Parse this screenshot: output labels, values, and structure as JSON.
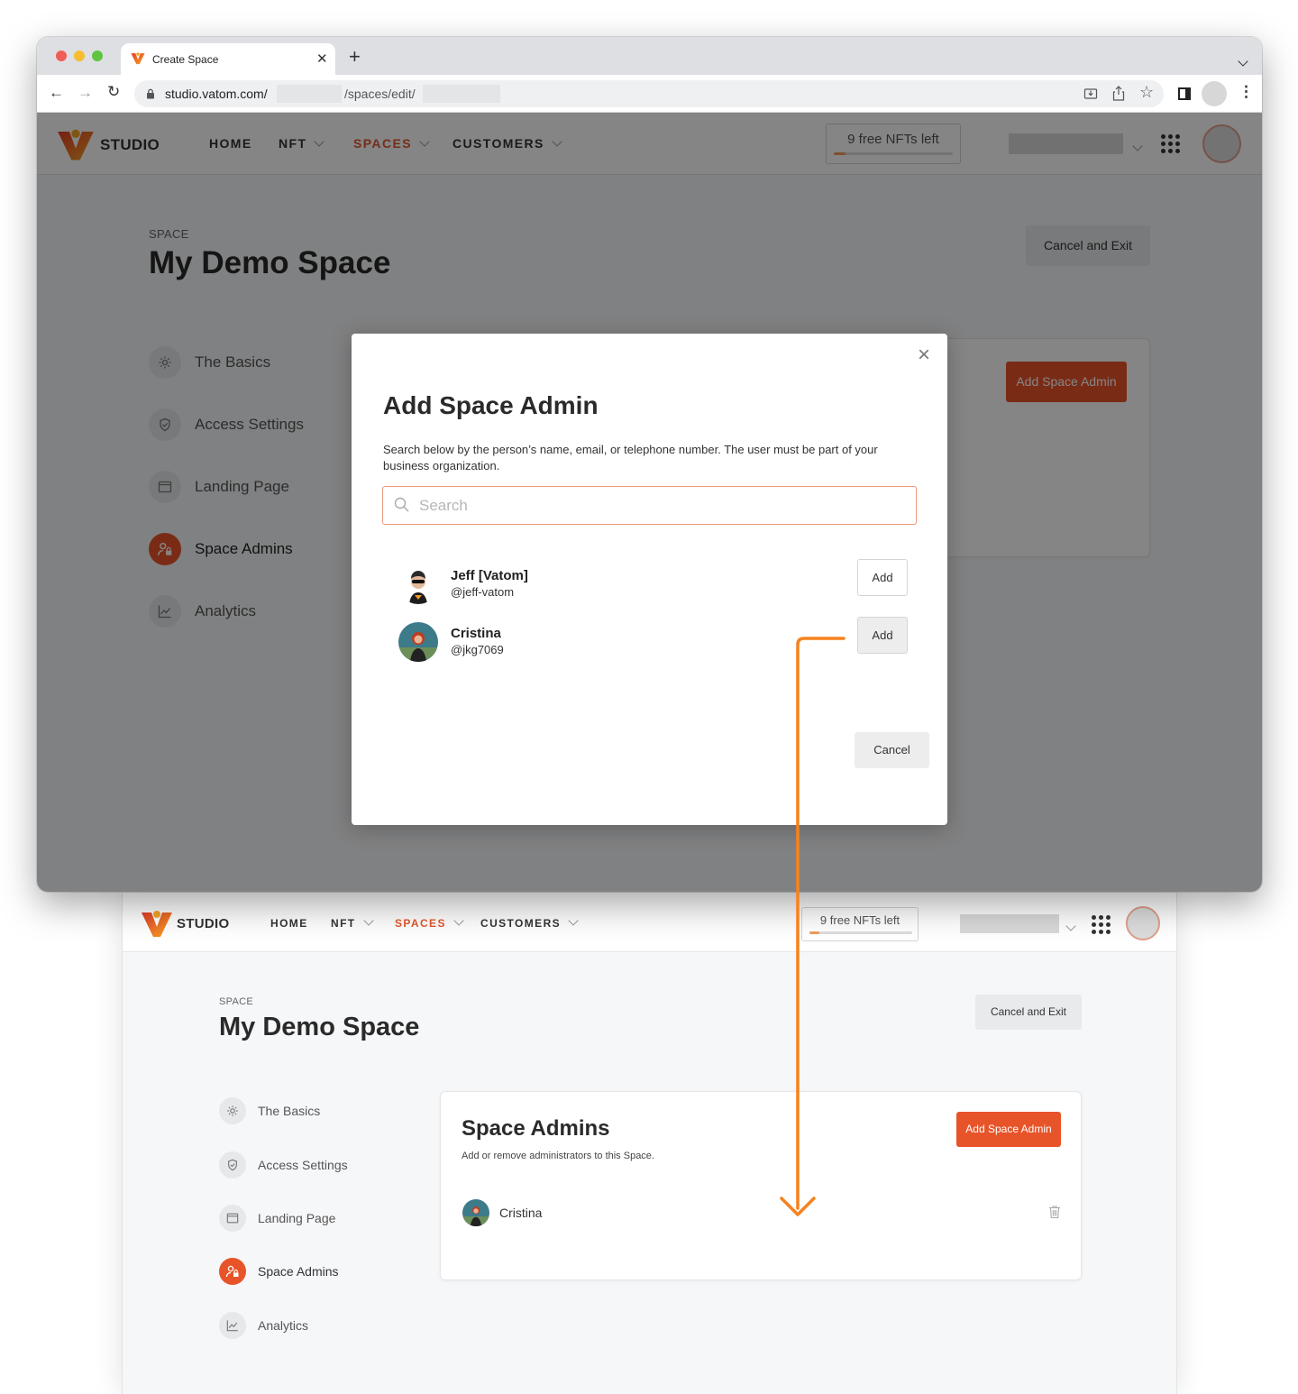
{
  "browser": {
    "tab_title": "Create Space",
    "new_tab_symbol": "+",
    "url_host": "studio.vatom.com/",
    "url_path": "/spaces/edit/"
  },
  "app": {
    "logo_text": "STUDIO",
    "nav": [
      {
        "label": "HOME",
        "has_dropdown": false,
        "active": false
      },
      {
        "label": "NFT",
        "has_dropdown": true,
        "active": false
      },
      {
        "label": "SPACES",
        "has_dropdown": true,
        "active": true
      },
      {
        "label": "CUSTOMERS",
        "has_dropdown": true,
        "active": false
      }
    ],
    "free_nfts_count": "9",
    "free_nfts_label": "free NFTs left",
    "free_nfts_fraction": 0.1,
    "space_label": "SPACE",
    "space_name": "My Demo Space",
    "cancel_exit_label": "Cancel and Exit",
    "sidebar": [
      {
        "label": "The Basics",
        "icon": "gear-icon"
      },
      {
        "label": "Access Settings",
        "icon": "shield-check-icon"
      },
      {
        "label": "Landing Page",
        "icon": "browser-window-icon"
      },
      {
        "label": "Space Admins",
        "icon": "user-lock-icon",
        "active": true
      },
      {
        "label": "Analytics",
        "icon": "line-chart-icon"
      }
    ],
    "add_space_admin_label": "Add Space Admin",
    "admins_title": "Space Admins",
    "admins_subtitle": "Add or remove administrators to this Space.",
    "admins": [
      {
        "name": "Cristina"
      }
    ]
  },
  "modal": {
    "title": "Add Space Admin",
    "description": "Search below by the person’s name, email, or telephone number. The user must be part of your business organization.",
    "search_placeholder": "Search",
    "results": [
      {
        "name": "Jeff [Vatom]",
        "handle": "@jeff-vatom",
        "add_label": "Add"
      },
      {
        "name": "Cristina",
        "handle": "@jkg7069",
        "add_label": "Add"
      }
    ],
    "cancel_label": "Cancel",
    "close_symbol": "×"
  },
  "colors": {
    "accent": "#e8542a",
    "arrow": "#f5821f"
  }
}
